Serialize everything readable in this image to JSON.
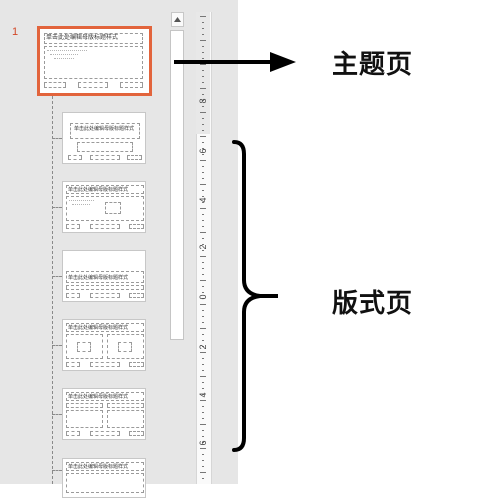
{
  "pane": {
    "slide_number": "1",
    "master_slide": {
      "title": "单击此处编辑母版标题样式"
    },
    "layouts": [
      {
        "title": "单击此处编辑母版标题样式"
      },
      {
        "title": "单击此处编辑母版标题样式"
      },
      {
        "title": "单击此处编辑母版标题样式"
      },
      {
        "title": "单击此处编辑母版标题样式"
      },
      {
        "title": "单击此处编辑母版标题样式"
      },
      {
        "title": "单击此处编辑母版标题样式"
      }
    ]
  },
  "ruler": {
    "labels": [
      "8",
      "6",
      "4",
      "2",
      "0",
      "2",
      "4",
      "6"
    ]
  },
  "annotations": {
    "master_label": "主题页",
    "layout_label": "版式页"
  },
  "colors": {
    "master_highlight": "#e2643c",
    "pane_background": "#e6e6e6"
  }
}
